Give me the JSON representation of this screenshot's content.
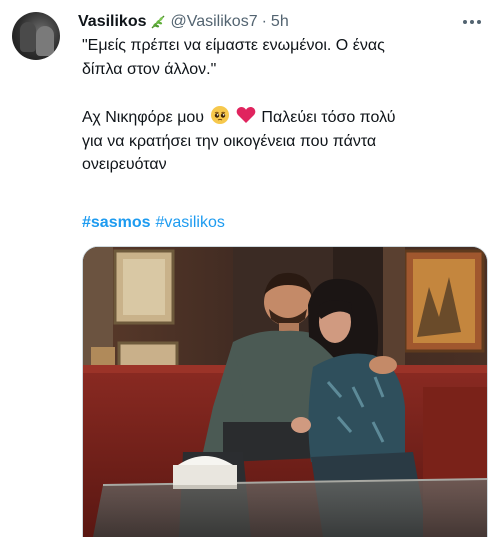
{
  "tweet": {
    "author_name": "Vasilikos",
    "author_handle": "@Vasilikos7",
    "separator": "·",
    "time": "5h",
    "text_line1": "\"Εμείς πρέπει να είμαστε ενωμένοι. Ο ένας",
    "text_line2": "δίπλα στον άλλον.\"",
    "text_line3_before": "Αχ Νικηφόρε μου",
    "text_line3_after": "Παλεύει τόσο πολύ",
    "text_line4": "για να κρατήσει την οικογένεια που πάντα",
    "text_line5": "ονειρευόταν",
    "hashtags": [
      "#sasmos",
      "#vasilikos"
    ]
  },
  "icons": {
    "name_badge": "leaf-icon",
    "emoji1": "pleading-face-emoji",
    "emoji2": "red-heart-emoji",
    "more": "more-icon"
  },
  "colors": {
    "link": "#1d9bf0",
    "secondary_text": "#536471",
    "primary_text": "#0f1419"
  }
}
